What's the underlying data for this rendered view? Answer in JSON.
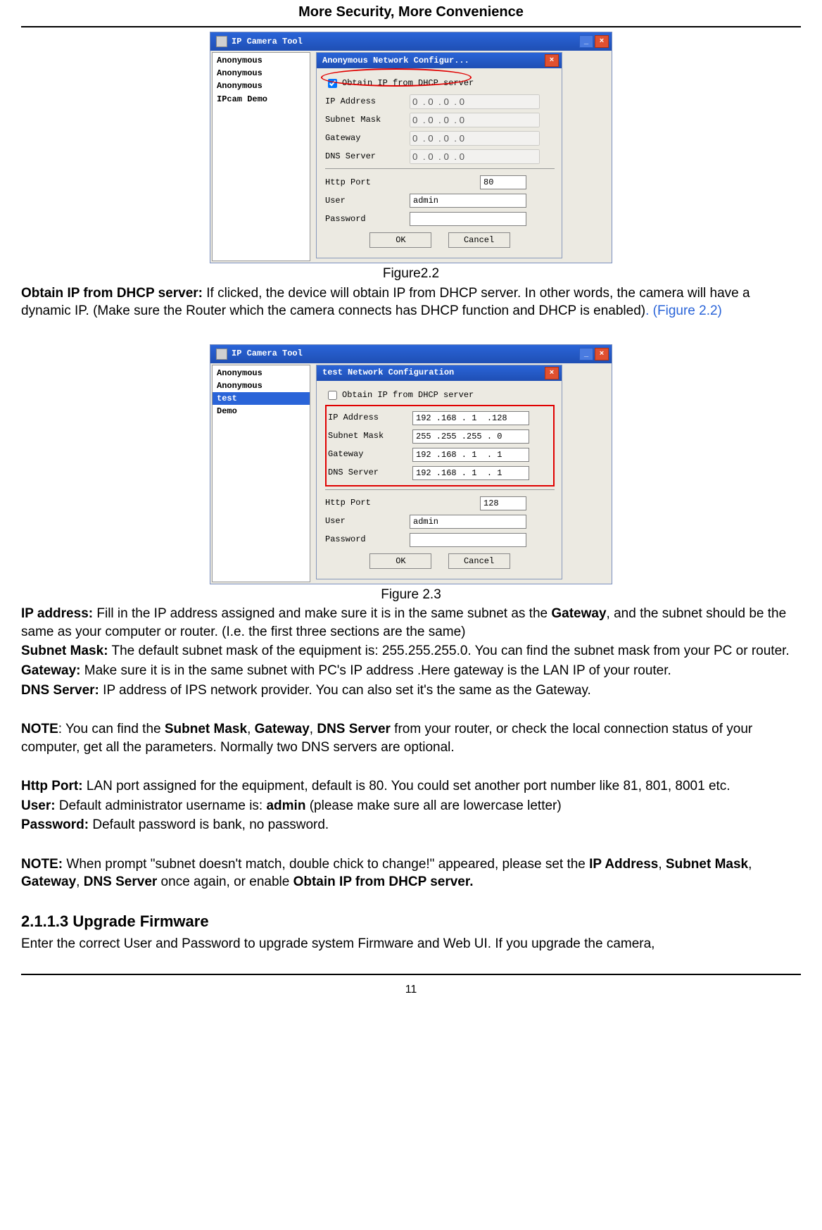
{
  "header": "More Security, More Convenience",
  "page_number": "11",
  "figure22": {
    "outer_title": "IP Camera Tool",
    "cameras": [
      "Anonymous",
      "Anonymous",
      "Anonymous",
      "IPcam Demo"
    ],
    "dialog_title": "Anonymous Network Configur...",
    "checkbox_label": "Obtain IP from DHCP server",
    "checkbox_checked": true,
    "fields": {
      "ip_label": "IP Address",
      "ip_value": "0  . 0  . 0  . 0",
      "mask_label": "Subnet Mask",
      "mask_value": "0  . 0  . 0  . 0",
      "gw_label": "Gateway",
      "gw_value": "0  . 0  . 0  . 0",
      "dns_label": "DNS Server",
      "dns_value": "0  . 0  . 0  . 0",
      "port_label": "Http Port",
      "port_value": "80",
      "user_label": "User",
      "user_value": "admin",
      "pwd_label": "Password",
      "pwd_value": ""
    },
    "ok": "OK",
    "cancel": "Cancel",
    "caption": "Figure2.2"
  },
  "para1_bold": "Obtain IP from DHCP server:",
  "para1_rest": " If clicked, the device will obtain IP from DHCP server. In other words, the camera will have a dynamic IP. (Make sure the Router which the camera connects has DHCP function and DHCP is enabled)",
  "para1_tail": ". (Figure 2.2)",
  "figure23": {
    "outer_title": "IP Camera Tool",
    "cameras": [
      "Anonymous",
      "Anonymous",
      "test",
      "Demo"
    ],
    "selected_index": 2,
    "dialog_title": "test Network Configuration",
    "checkbox_label": "Obtain IP from DHCP server",
    "checkbox_checked": false,
    "fields": {
      "ip_label": "IP Address",
      "ip_value": "192 .168 . 1  .128",
      "mask_label": "Subnet Mask",
      "mask_value": "255 .255 .255 . 0",
      "gw_label": "Gateway",
      "gw_value": "192 .168 . 1  . 1",
      "dns_label": "DNS Server",
      "dns_value": "192 .168 . 1  . 1",
      "port_label": "Http Port",
      "port_value": "128",
      "user_label": "User",
      "user_value": "admin",
      "pwd_label": "Password",
      "pwd_value": ""
    },
    "ok": "OK",
    "cancel": "Cancel",
    "caption": "Figure 2.3"
  },
  "body": {
    "ip_b": "IP address:",
    "ip_t1": " Fill in the IP address assigned and make sure it is in the same subnet as the ",
    "ip_b2": "Gateway",
    "ip_t2": ", and the subnet should be the same as your computer or router. (I.e. the first three sections are the same)",
    "mask_b": "Subnet Mask:",
    "mask_t": " The default subnet mask of the equipment is: 255.255.255.0. You can find the subnet mask from your PC or router.",
    "gw_b": "Gateway:",
    "gw_t": " Make sure it is in the same subnet with PC's IP address .Here gateway is the LAN IP of your router.",
    "dns_b": "DNS Server:",
    "dns_t": " IP address of IPS network provider. You can also set it's the same as the Gateway.",
    "note1_b": "NOTE",
    "note1_t1": ": You can find the ",
    "note1_b2": "Subnet Mask",
    "note1_c": ", ",
    "note1_b3": "Gateway",
    "note1_b4": "DNS Server",
    "note1_t2": " from your router, or check the local connection status of your computer, get all the parameters. Normally two DNS servers are optional.",
    "http_b": "Http Port:",
    "http_t": " LAN port assigned for the equipment, default is 80. You could set another port number like 81, 801, 8001 etc.",
    "user_b": "User:",
    "user_t1": " Default administrator username is: ",
    "user_b2": "admin",
    "user_t2": " (please make sure all are lowercase letter)",
    "pwd_b": "Password:",
    "pwd_t": " Default password is bank, no password.",
    "note2_b": "NOTE:",
    "note2_t1": " When prompt \"subnet doesn't match, double chick to change!\" appeared, please set the ",
    "note2_b2": "IP Address",
    "note2_b3": "Subnet Mask",
    "note2_b4": "Gateway",
    "note2_b5": "DNS Server",
    "note2_t2": " once again, or enable ",
    "note2_b6": "Obtain IP from DHCP server."
  },
  "section_heading": "2.1.1.3 Upgrade Firmware",
  "section_text": "Enter the correct User and Password to upgrade system Firmware and Web UI. If you upgrade the camera,"
}
